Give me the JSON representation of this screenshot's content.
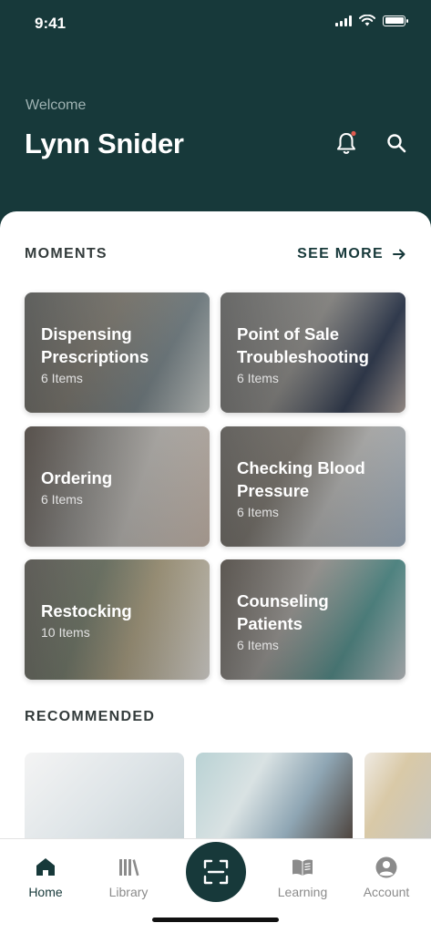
{
  "status": {
    "time": "9:41"
  },
  "header": {
    "welcome": "Welcome",
    "user_name": "Lynn Snider",
    "bell_icon": "bell-icon",
    "search_icon": "search-icon"
  },
  "moments": {
    "label": "MOMENTS",
    "see_more": "SEE MORE",
    "cards": [
      {
        "title": "Dispensing Prescriptions",
        "count": "6 Items"
      },
      {
        "title": "Point of Sale Troubleshooting",
        "count": "6 Items"
      },
      {
        "title": "Ordering",
        "count": "6 Items"
      },
      {
        "title": "Checking Blood Pressure",
        "count": "6 Items"
      },
      {
        "title": "Restocking",
        "count": "10 Items"
      },
      {
        "title": "Counseling Patients",
        "count": "6 Items"
      }
    ]
  },
  "recommended": {
    "label": "RECOMMENDED"
  },
  "tabbar": {
    "home": "Home",
    "library": "Library",
    "learning": "Learning",
    "account": "Account",
    "active": "Home"
  },
  "colors": {
    "brand": "#17393a",
    "accent_dot": "#e05a4f"
  }
}
